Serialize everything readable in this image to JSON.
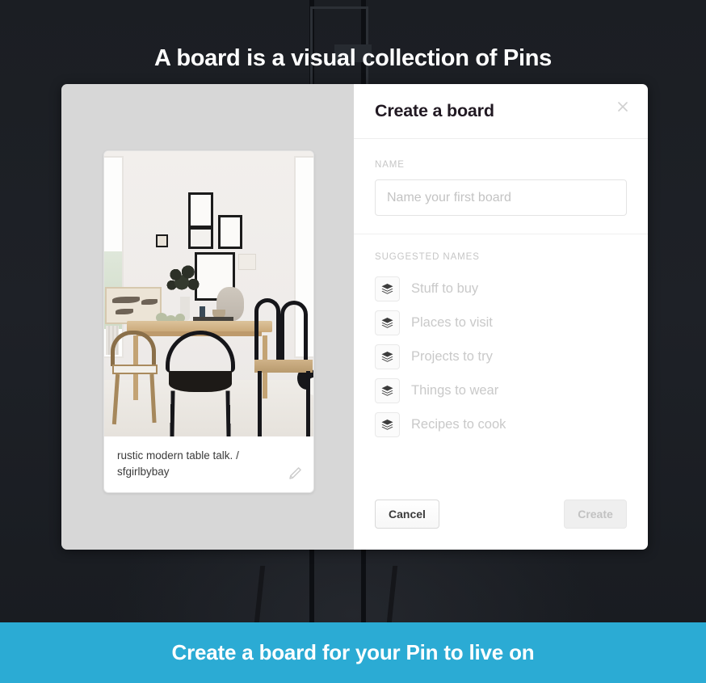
{
  "headline": "A board is a visual collection of Pins",
  "modal": {
    "title": "Create a board",
    "close_icon": "close-icon",
    "name_section": {
      "label": "NAME",
      "input_value": "",
      "input_placeholder": "Name your first board"
    },
    "suggested_section": {
      "label": "SUGGESTED NAMES",
      "items": [
        {
          "label": "Stuff to buy",
          "icon": "layers-icon"
        },
        {
          "label": "Places to visit",
          "icon": "layers-icon"
        },
        {
          "label": "Projects to try",
          "icon": "layers-icon"
        },
        {
          "label": "Things to wear",
          "icon": "layers-icon"
        },
        {
          "label": "Recipes to cook",
          "icon": "layers-icon"
        }
      ]
    },
    "footer": {
      "cancel_label": "Cancel",
      "create_label": "Create"
    }
  },
  "pin_preview": {
    "caption": "rustic modern table talk. / sfgirlbybay",
    "edit_icon": "pencil-icon",
    "image_alt": "scandinavian dining room with wooden table and black chairs"
  },
  "bottom_banner": {
    "text": "Create a board for your Pin to live on",
    "color": "#2babd4"
  },
  "colors": {
    "banner_blue": "#2babd4",
    "backdrop_dark": "#1d2025",
    "preview_pane_gray": "#d7d7d7",
    "modal_white": "#ffffff",
    "muted_text": "#c9c9c9"
  }
}
